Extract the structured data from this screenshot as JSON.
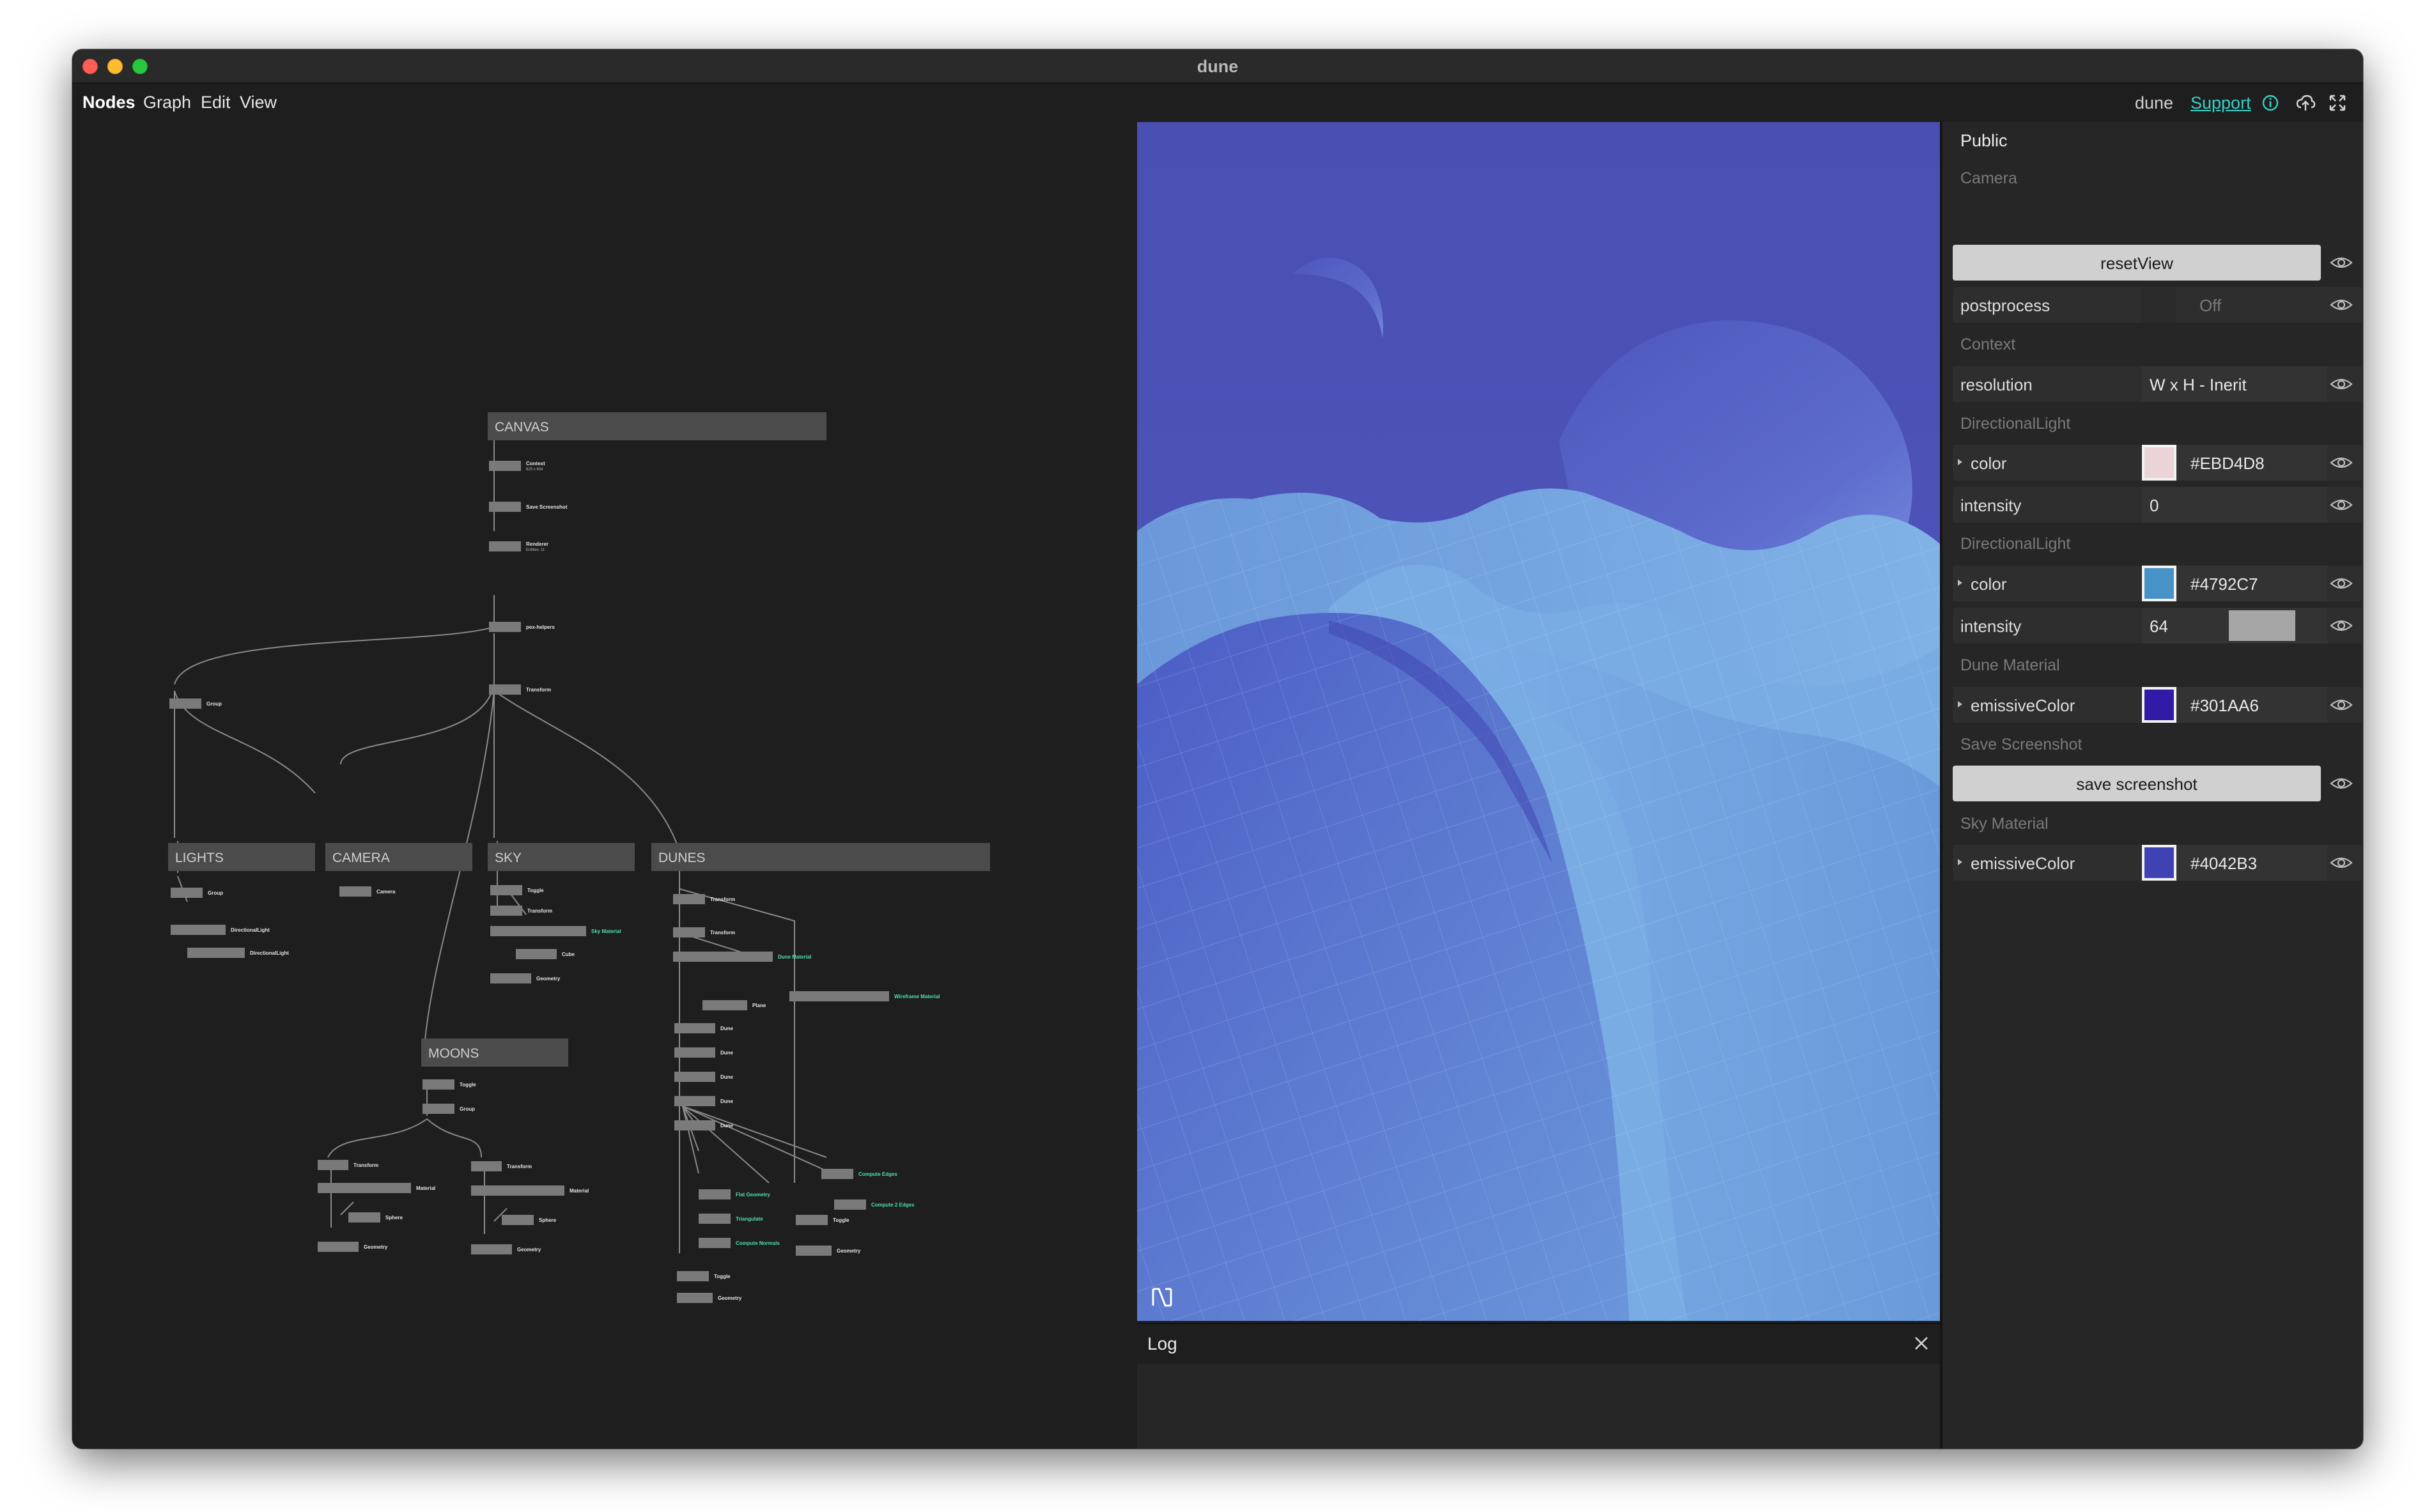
{
  "window": {
    "title": "dune"
  },
  "menu": {
    "items": [
      {
        "label": "Nodes",
        "active": true
      },
      {
        "label": "Graph",
        "active": false
      },
      {
        "label": "Edit",
        "active": false
      },
      {
        "label": "View",
        "active": false
      }
    ],
    "project_name": "dune",
    "support_label": "Support"
  },
  "graph": {
    "groups": {
      "canvas": "CANVAS",
      "lights": "LIGHTS",
      "camera": "CAMERA",
      "sky": "SKY",
      "dunes": "DUNES",
      "moons": "MOONS"
    },
    "nodes": {
      "context": "Context",
      "context_sub": "625 x 934",
      "save_screenshot": "Save Screenshot",
      "renderer": "Renderer",
      "renderer_sub": "Entities: 11",
      "pex_helpers": "pex-helpers",
      "transform_root": "Transform",
      "group_lights": "Group",
      "lights_group": "Group",
      "directional_light_1": "DirectionalLight",
      "directional_light_2": "DirectionalLight",
      "camera": "Camera",
      "sky_toggle": "Toggle",
      "sky_transform": "Transform",
      "sky_material": "Sky Material",
      "sky_cube": "Cube",
      "sky_geometry": "Geometry",
      "dunes_transform_1": "Transform",
      "dunes_transform_2": "Transform",
      "dune_material": "Dune Material",
      "wireframe_material": "Wireframe Material",
      "plane": "Plane",
      "dune_1": "Dune",
      "dune_2": "Dune",
      "dune_3": "Dune",
      "dune_4": "Dune",
      "dune_5": "Dune",
      "compute_edges": "Compute Edges",
      "flat_geometry": "Flat Geometry",
      "compute_2_edges": "Compute 2 Edges",
      "triangulate": "Triangulate",
      "dunes_toggle_a": "Toggle",
      "compute_normals": "Compute Normals",
      "dunes_geometry_a": "Geometry",
      "dunes_toggle_b": "Toggle",
      "dunes_geometry_b": "Geometry",
      "moons_toggle": "Toggle",
      "moons_group": "Group",
      "moon1_transform": "Transform",
      "moon1_material": "Material",
      "moon1_sphere": "Sphere",
      "moon1_geometry": "Geometry",
      "moon2_transform": "Transform",
      "moon2_material": "Material",
      "moon2_sphere": "Sphere",
      "moon2_geometry": "Geometry"
    }
  },
  "preview": {
    "sky_color": "#4d52b6",
    "moon_color": "#5f6fd0",
    "dune_color": "#6f9ddc"
  },
  "log": {
    "title": "Log"
  },
  "panel": {
    "title": "Public",
    "sections": {
      "camera": "Camera",
      "context": "Context",
      "directional_light_1": "DirectionalLight",
      "directional_light_2": "DirectionalLight",
      "dune_material": "Dune Material",
      "save_screenshot": "Save Screenshot",
      "sky_material": "Sky Material"
    },
    "reset_view": "resetView",
    "postprocess": {
      "label": "postprocess",
      "value": "Off"
    },
    "resolution": {
      "label": "resolution",
      "value": "W x H - Inerit"
    },
    "light1_color": {
      "label": "color",
      "value": "#EBD4D8",
      "swatch": "#ebd4d8"
    },
    "light1_intensity": {
      "label": "intensity",
      "value": "0"
    },
    "light2_color": {
      "label": "color",
      "value": "#4792C7",
      "swatch": "#4792c7"
    },
    "light2_intensity": {
      "label": "intensity",
      "value": "64"
    },
    "dune_emissive": {
      "label": "emissiveColor",
      "value": "#301AA6",
      "swatch": "#301aa6"
    },
    "save_screenshot_button": "save screenshot",
    "sky_emissive": {
      "label": "emissiveColor",
      "value": "#4042B3",
      "swatch": "#4042b3"
    }
  }
}
